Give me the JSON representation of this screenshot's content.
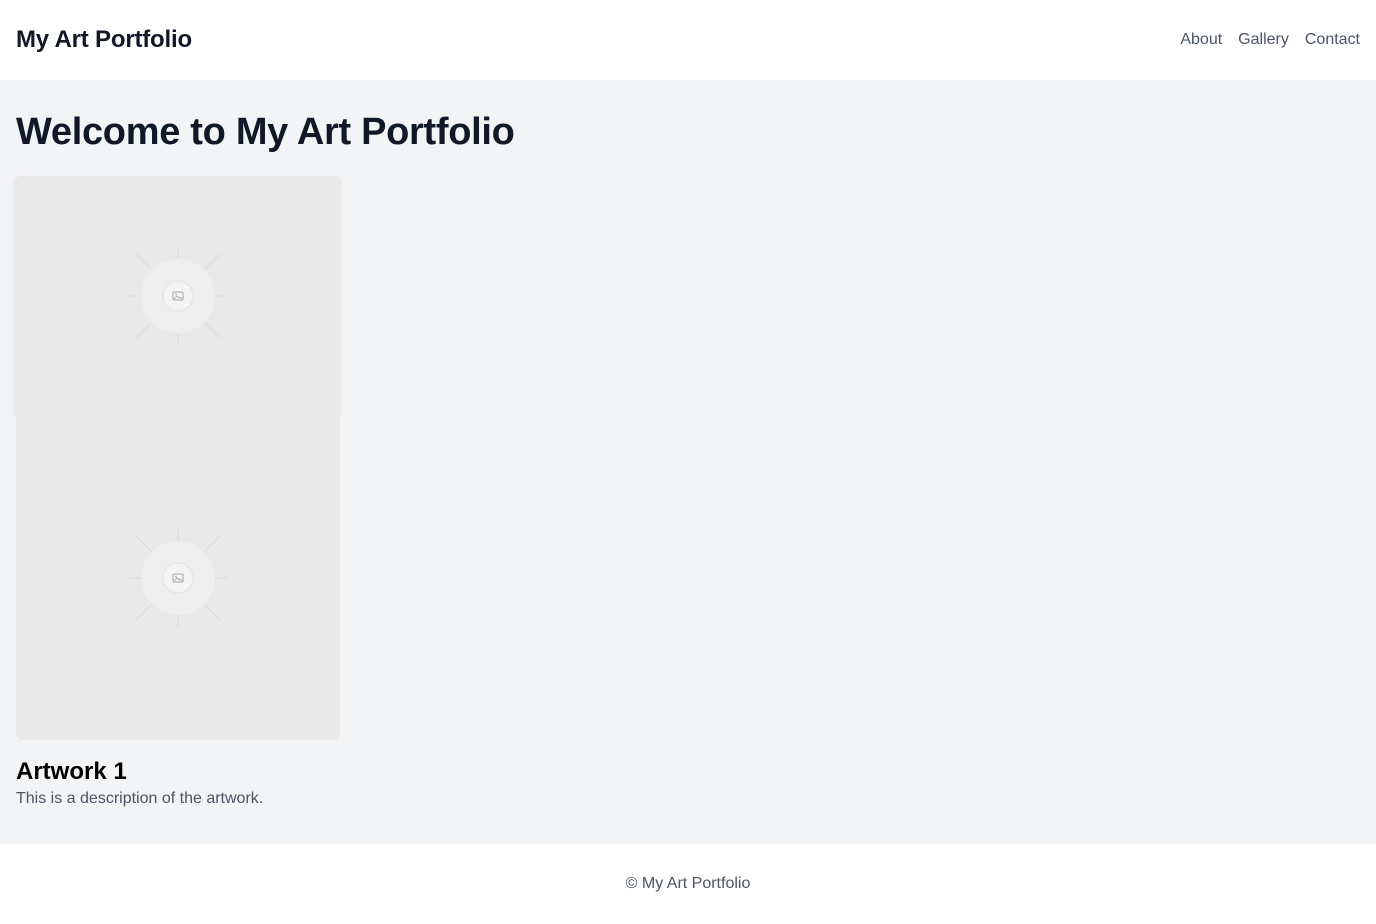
{
  "header": {
    "site_title": "My Art Portfolio",
    "nav": [
      {
        "label": "About"
      },
      {
        "label": "Gallery"
      },
      {
        "label": "Contact"
      }
    ]
  },
  "main": {
    "heading": "Welcome to My Art Portfolio",
    "artworks": [
      {
        "title": "Artwork 1",
        "description": "This is a description of the artwork.",
        "image_icons": [
          "image-placeholder-icon",
          "image-placeholder-icon"
        ]
      }
    ]
  },
  "footer": {
    "copyright": "© My Art Portfolio"
  },
  "colors": {
    "page_bg": "#f3f4f6",
    "header_bg": "#ffffff",
    "text_dark": "#111827",
    "text_muted": "#4b5563",
    "placeholder_bg": "#e9e9e9"
  }
}
